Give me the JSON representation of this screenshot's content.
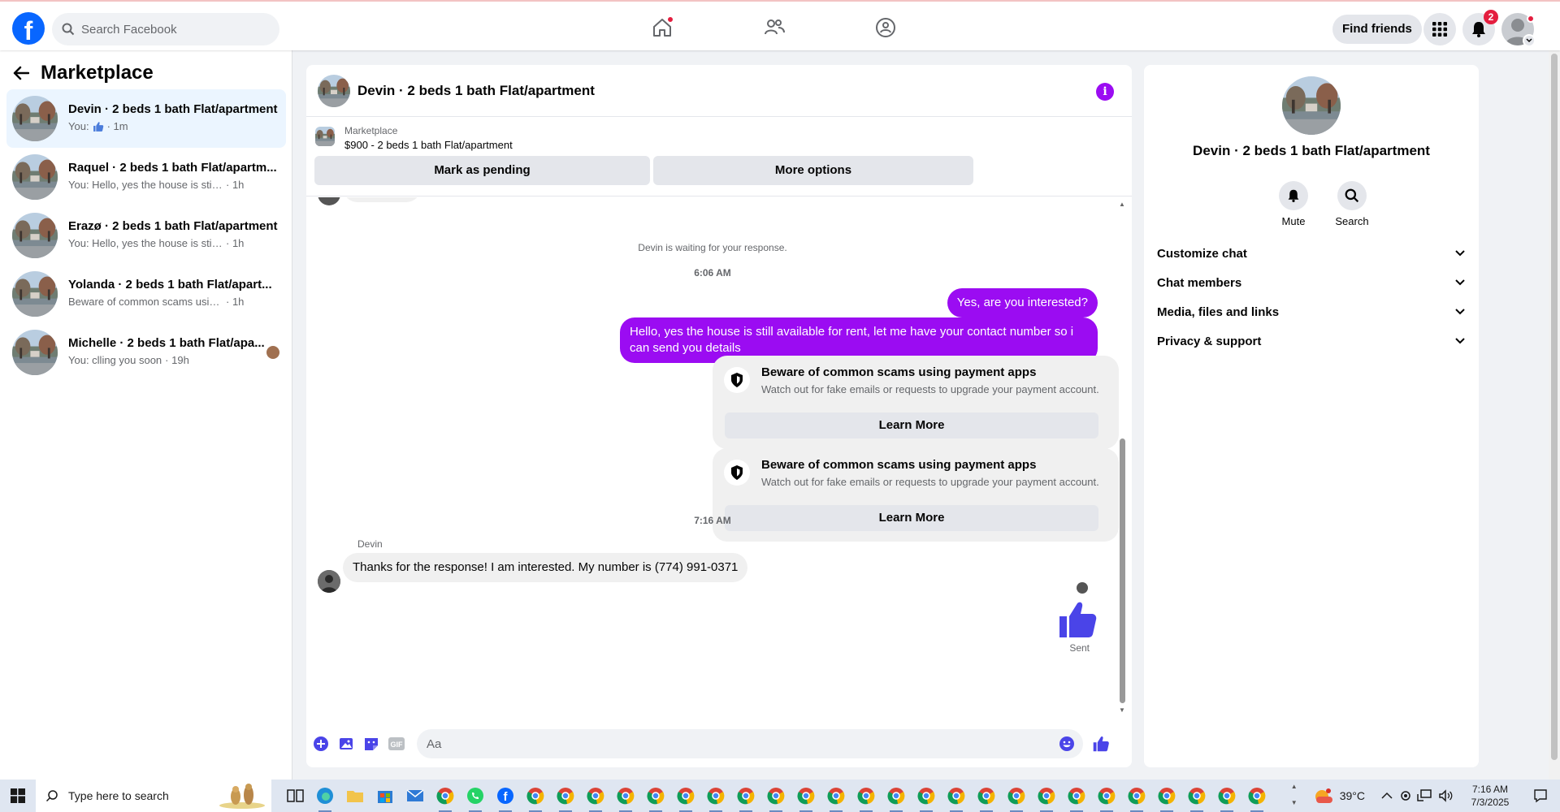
{
  "topbar": {
    "logo_letter": "f",
    "search_placeholder": "Search Facebook",
    "find_friends_label": "Find friends",
    "notification_count": "2"
  },
  "sidebar": {
    "title": "Marketplace",
    "conversations": [
      {
        "title": "Devin · 2 beds 1 bath Flat/apartment",
        "prefix": "You:",
        "preview": "",
        "time": "· 1m",
        "active": true
      },
      {
        "title": "Raquel · 2 beds 1 bath Flat/apartm...",
        "prefix": "",
        "preview": "You: Hello, yes the house is still availa...",
        "time": "· 1h"
      },
      {
        "title": "Erazø · 2 beds 1 bath Flat/apartment",
        "prefix": "",
        "preview": "You: Hello, yes the house is still availa...",
        "time": "· 1h"
      },
      {
        "title": "Yolanda · 2 beds 1 bath Flat/apart...",
        "prefix": "",
        "preview": "Beware of common scams using pay...",
        "time": "· 1h"
      },
      {
        "title": "Michelle · 2 beds 1 bath Flat/apa...",
        "prefix": "",
        "preview": "You: clling you soon",
        "time": "· 19h"
      }
    ]
  },
  "chat": {
    "title": "Devin · 2 beds 1 bath Flat/apartment",
    "info_glyph": "i",
    "listing_label": "Marketplace",
    "listing_price": "$900 - 2 beds 1 bath Flat/apartment",
    "mark_pending_label": "Mark as pending",
    "more_options_label": "More options",
    "waiting_text": "Devin is waiting for your response.",
    "time_1": "6:06 AM",
    "msg_out_1": "Yes, are you interested?",
    "msg_out_2": "Hello, yes the house is still available for rent, let me have your contact number so i can send you details",
    "scam_title": "Beware of common scams using payment apps",
    "scam_desc": "Watch out for fake emails or requests to upgrade your payment account.",
    "learn_more": "Learn More",
    "time_2": "7:16 AM",
    "sender_name": "Devin",
    "msg_in_1": "Thanks for the response! I am interested. My number is (774) 991-0371",
    "sent_label": "Sent",
    "composer_placeholder": "Aa",
    "accent_color": "#9b0cf2"
  },
  "info_panel": {
    "title": "Devin · 2 beds 1 bath Flat/apartment",
    "mute_label": "Mute",
    "search_label": "Search",
    "sections": [
      "Customize chat",
      "Chat members",
      "Media, files and links",
      "Privacy & support"
    ]
  },
  "taskbar": {
    "search_placeholder": "Type here to search",
    "temperature": "39°C",
    "time": "7:16 AM",
    "date": "7/3/2025"
  }
}
